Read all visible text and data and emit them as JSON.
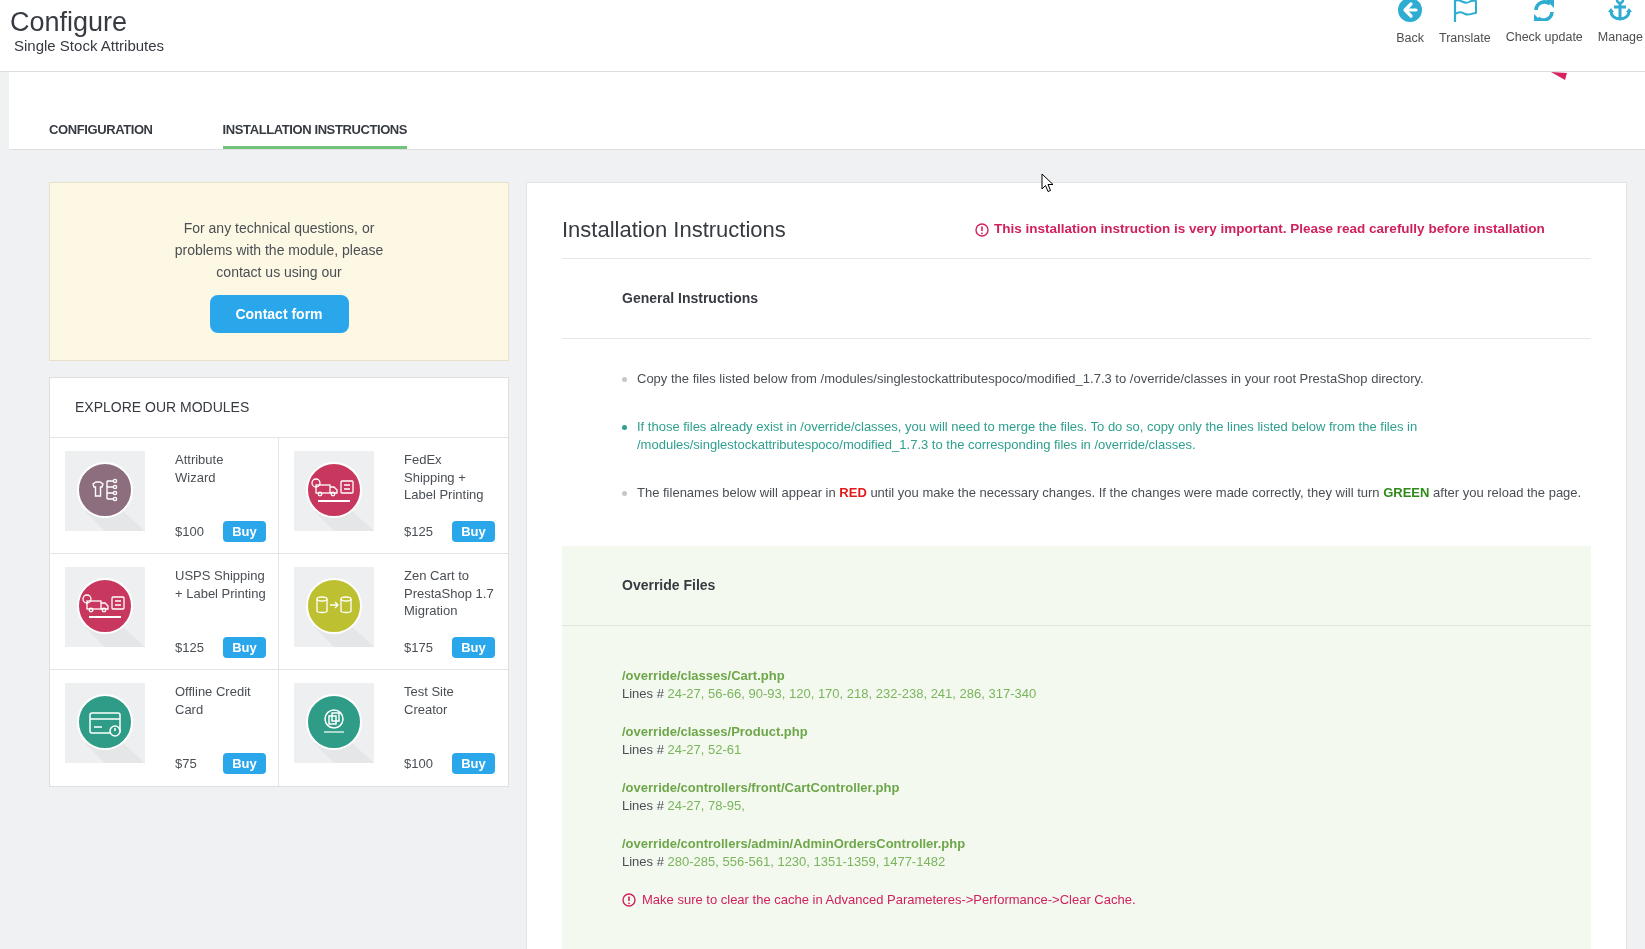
{
  "header": {
    "title": "Configure",
    "subtitle": "Single Stock Attributes",
    "toolbar": [
      {
        "label": "Back",
        "kind": "back"
      },
      {
        "label": "Translate",
        "kind": "flag"
      },
      {
        "label": "Check update",
        "kind": "refresh"
      },
      {
        "label": "Manage",
        "kind": "anchor"
      }
    ]
  },
  "tabs": [
    {
      "label": "CONFIGURATION",
      "selected": false
    },
    {
      "label": "INSTALLATION INSTRUCTIONS",
      "selected": true
    }
  ],
  "support": {
    "message": "For any technical questions, or problems with the module, please contact us using our",
    "button": "Contact form"
  },
  "modules": {
    "title": "EXPLORE OUR MODULES",
    "items": [
      {
        "name": "Attribute Wizard",
        "price": "$100",
        "button": "Buy",
        "kind": "tree",
        "color": "#8d6e7f"
      },
      {
        "name": "FedEx Shipping + Label Printing",
        "price": "$125",
        "button": "Buy",
        "kind": "truck",
        "color": "#c8385e"
      },
      {
        "name": "USPS Shipping + Label Printing",
        "price": "$125",
        "button": "Buy",
        "kind": "truck",
        "color": "#c8385e"
      },
      {
        "name": "Zen Cart to PrestaShop 1.7 Migration",
        "price": "$175",
        "button": "Buy",
        "kind": "database",
        "color": "#bdc030"
      },
      {
        "name": "Offline Credit Card",
        "price": "$75",
        "button": "Buy",
        "kind": "card",
        "color": "#2f9c87"
      },
      {
        "name": "Test Site Creator",
        "price": "$100",
        "button": "Buy",
        "kind": "copy",
        "color": "#2f9c87"
      }
    ]
  },
  "instructions": {
    "title": "Installation Instructions",
    "warning": "This installation instruction is very important. Please read carefully before installation",
    "general": {
      "heading": "General Instructions",
      "items": [
        {
          "kind": "plain",
          "segments": [
            {
              "text": "Copy the files listed below from /modules/singlestockattributespoco/modified_1.7.3 to /override/classes in your root PrestaShop directory."
            }
          ]
        },
        {
          "kind": "note",
          "segments": [
            {
              "text": "If those files already exist in /override/classes, you will need to merge the files. To do so, copy only the lines listed below from the files in /modules/singlestockattributespoco/modified_1.7.3 to the corresponding files in /override/classes."
            }
          ]
        },
        {
          "kind": "plain",
          "segments": [
            {
              "text": "The filenames below will appear in "
            },
            {
              "text": "RED",
              "color": "#e3191c"
            },
            {
              "text": " until you make the necessary changes. If the changes were made correctly, they will turn "
            },
            {
              "text": "GREEN",
              "color": "#2f8a1b"
            },
            {
              "text": " after you reload the page."
            }
          ]
        }
      ]
    },
    "overrides": {
      "heading": "Override Files",
      "files": [
        {
          "path": "/override/classes/Cart.php",
          "valid": true,
          "lines_label": "Lines #",
          "lines": "24-27, 56-66, 90-93, 120, 170, 218, 232-238, 241, 286, 317-340"
        },
        {
          "path": "/override/classes/Product.php",
          "valid": true,
          "lines_label": "Lines #",
          "lines": "24-27, 52-61"
        },
        {
          "path": "/override/controllers/front/CartController.php",
          "valid": true,
          "lines_label": "Lines #",
          "lines": "24-27, 78-95,"
        },
        {
          "path": "/override/controllers/admin/AdminOrdersController.php",
          "valid": true,
          "lines_label": "Lines #",
          "lines": "280-285, 556-561, 1230, 1351-1359, 1477-1482"
        }
      ],
      "note": "Make sure to clear the cache in Advanced Parameteres->Performance->Clear Cache."
    }
  }
}
